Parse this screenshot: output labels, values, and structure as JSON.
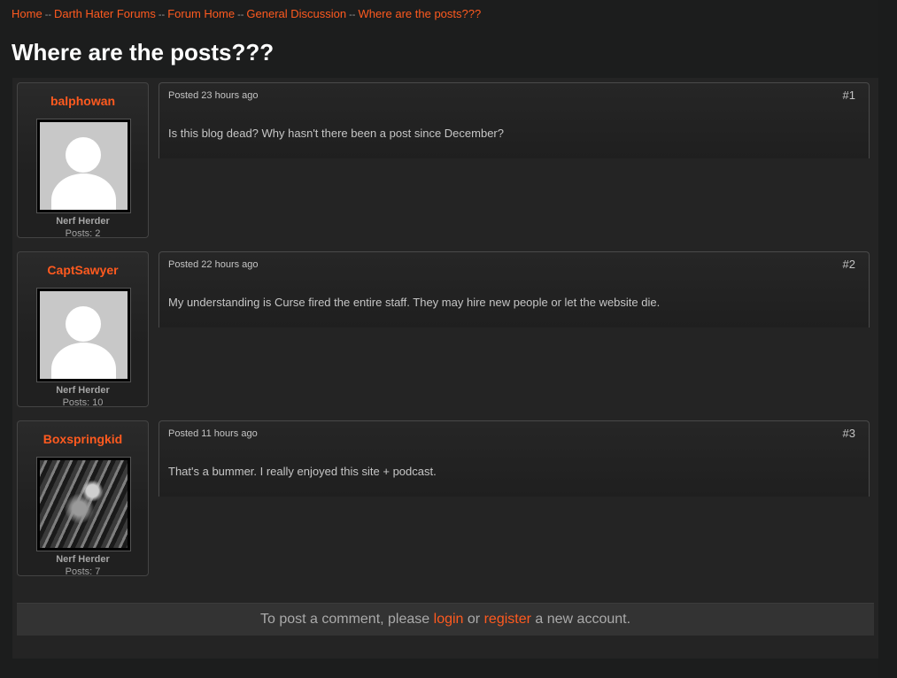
{
  "breadcrumb": {
    "items": [
      "Home",
      "Darth Hater Forums",
      "Forum Home",
      "General Discussion",
      "Where are the posts???"
    ],
    "separator": "--"
  },
  "thread": {
    "title": "Where are the posts???"
  },
  "posts": [
    {
      "author": "balphowan",
      "avatar_icon": "default-user-avatar-icon",
      "rank": "Nerf Herder",
      "posts_count": "Posts: 2",
      "posted": "Posted 23 hours ago",
      "number": "#1",
      "text": "Is this blog dead? Why hasn't there been a post since December?"
    },
    {
      "author": "CaptSawyer",
      "avatar_icon": "default-user-avatar-icon",
      "rank": "Nerf Herder",
      "posts_count": "Posts: 10",
      "posted": "Posted 22 hours ago",
      "number": "#2",
      "text": "My understanding is Curse fired the entire staff.  They may hire new people or let the website die."
    },
    {
      "author": "Boxspringkid",
      "avatar_icon": "photo-avatar",
      "rank": "Nerf Herder",
      "posts_count": "Posts: 7",
      "posted": "Posted 11 hours ago",
      "number": "#3",
      "text": "That's a bummer. I really enjoyed this site + podcast."
    }
  ],
  "comment_prompt": {
    "prefix": "To post a comment, please",
    "login": "login",
    "middle": "or",
    "register": "register",
    "suffix": "a new account."
  },
  "colors": {
    "accent": "#ff5a1f",
    "background": "#1c1d1d",
    "panel": "#242424",
    "title": "#ffffff"
  }
}
